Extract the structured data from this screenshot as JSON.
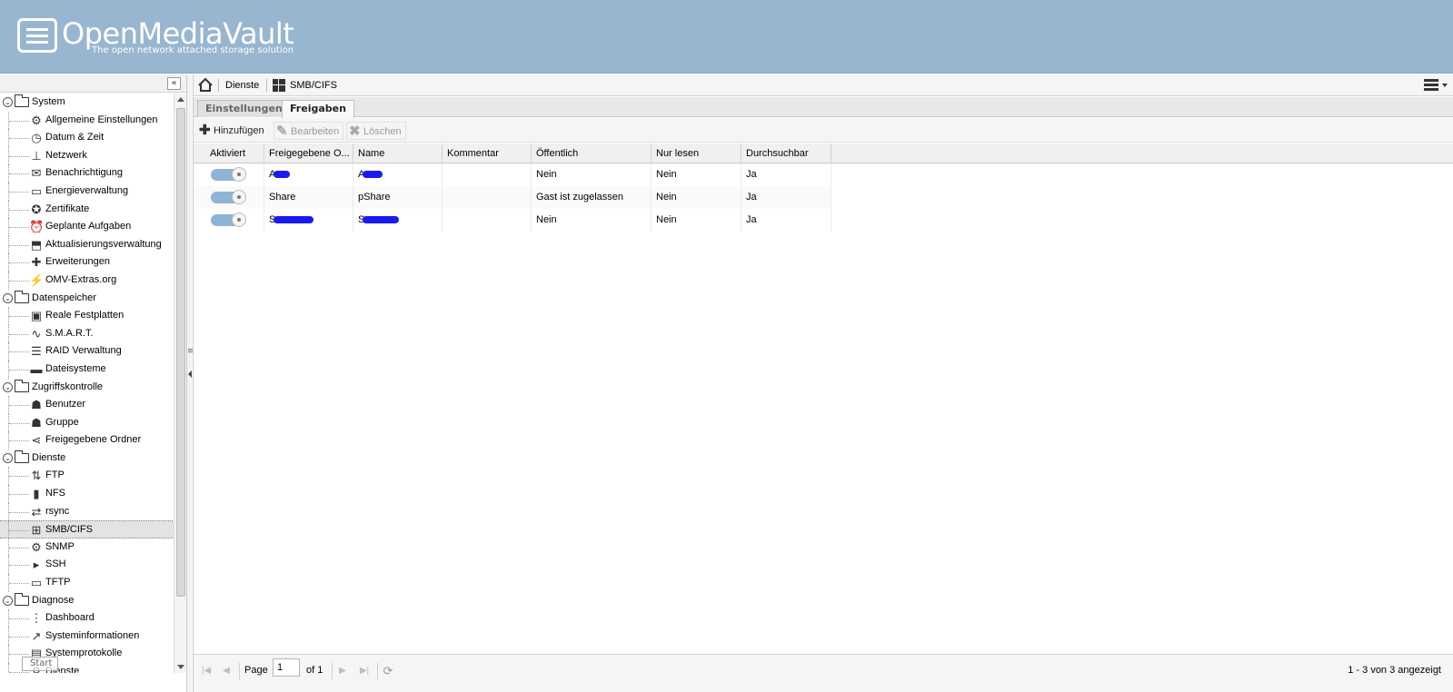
{
  "app": {
    "title": "OpenMediaVault",
    "subtitle": "The open network attached storage solution"
  },
  "sidebar": {
    "collapse_label": "«",
    "groups": [
      {
        "label": "System",
        "items": [
          {
            "label": "Allgemeine Einstellungen",
            "icon": "gear-icon",
            "glyph": "⚙"
          },
          {
            "label": "Datum & Zeit",
            "icon": "clock-icon",
            "glyph": "◷"
          },
          {
            "label": "Netzwerk",
            "icon": "network-icon",
            "glyph": "⊥"
          },
          {
            "label": "Benachrichtigung",
            "icon": "envelope-icon",
            "glyph": "✉"
          },
          {
            "label": "Energieverwaltung",
            "icon": "battery-icon",
            "glyph": "▭"
          },
          {
            "label": "Zertifikate",
            "icon": "certificate-icon",
            "glyph": "✪"
          },
          {
            "label": "Geplante Aufgaben",
            "icon": "alarm-clock-icon",
            "glyph": "⏰"
          },
          {
            "label": "Aktualisierungsverwaltung",
            "icon": "update-icon",
            "glyph": "⬒"
          },
          {
            "label": "Erweiterungen",
            "icon": "puzzle-icon",
            "glyph": "✚"
          },
          {
            "label": "OMV-Extras.org",
            "icon": "plug-icon",
            "glyph": "⚡"
          }
        ]
      },
      {
        "label": "Datenspeicher",
        "items": [
          {
            "label": "Reale Festplatten",
            "icon": "disk-icon",
            "glyph": "▣"
          },
          {
            "label": "S.M.A.R.T.",
            "icon": "heartbeat-icon",
            "glyph": "∿"
          },
          {
            "label": "RAID Verwaltung",
            "icon": "database-icon",
            "glyph": "☰"
          },
          {
            "label": "Dateisysteme",
            "icon": "folder-icon",
            "glyph": "▬"
          }
        ]
      },
      {
        "label": "Zugriffskontrolle",
        "items": [
          {
            "label": "Benutzer",
            "icon": "user-icon",
            "glyph": "☗"
          },
          {
            "label": "Gruppe",
            "icon": "group-icon",
            "glyph": "☗"
          },
          {
            "label": "Freigegebene Ordner",
            "icon": "share-icon",
            "glyph": "⋖"
          }
        ]
      },
      {
        "label": "Dienste",
        "items": [
          {
            "label": "FTP",
            "icon": "ftp-icon",
            "glyph": "⇅"
          },
          {
            "label": "NFS",
            "icon": "nfs-icon",
            "glyph": "▮"
          },
          {
            "label": "rsync",
            "icon": "rsync-icon",
            "glyph": "⇄"
          },
          {
            "label": "SMB/CIFS",
            "icon": "windows-icon",
            "glyph": "⊞",
            "selected": true
          },
          {
            "label": "SNMP",
            "icon": "snmp-icon",
            "glyph": "⚙"
          },
          {
            "label": "SSH",
            "icon": "terminal-icon",
            "glyph": "▸"
          },
          {
            "label": "TFTP",
            "icon": "monitor-icon",
            "glyph": "▭"
          }
        ]
      },
      {
        "label": "Diagnose",
        "items": [
          {
            "label": "Dashboard",
            "icon": "dashboard-icon",
            "glyph": "⋮"
          },
          {
            "label": "Systeminformationen",
            "icon": "chart-line-icon",
            "glyph": "↗"
          },
          {
            "label": "Systemprotokolle",
            "icon": "log-icon",
            "glyph": "▤"
          },
          {
            "label": "Dienste",
            "icon": "services-icon",
            "glyph": "⚲"
          }
        ]
      }
    ],
    "start_label": "Start"
  },
  "breadcrumb": {
    "items": [
      "Dienste",
      "SMB/CIFS"
    ]
  },
  "tabs": [
    {
      "label": "Einstellungen",
      "active": false
    },
    {
      "label": "Freigaben",
      "active": true
    }
  ],
  "toolbar": {
    "add_label": "Hinzufügen",
    "edit_label": "Bearbeiten",
    "delete_label": "Löschen"
  },
  "grid": {
    "columns": [
      "Aktiviert",
      "Freigegebene O...",
      "Name",
      "Kommentar",
      "Öffentlich",
      "Nur lesen",
      "Durchsuchbar"
    ],
    "rows": [
      {
        "enabled": true,
        "shared_folder": "A",
        "name": "A",
        "comment": "",
        "public": "Nein",
        "readonly": "Nein",
        "browseable": "Ja"
      },
      {
        "enabled": true,
        "shared_folder": "Share",
        "name": "pShare",
        "comment": "",
        "public": "Gast ist zugelassen",
        "readonly": "Nein",
        "browseable": "Ja"
      },
      {
        "enabled": true,
        "shared_folder": "S",
        "name": "S",
        "comment": "",
        "public": "Nein",
        "readonly": "Nein",
        "browseable": "Ja"
      }
    ]
  },
  "pager": {
    "page_label": "Page",
    "page_value": "1",
    "of_label": "of 1",
    "status": "1 - 3 von 3 angezeigt"
  },
  "colors": {
    "header_bg": "#98b6d0",
    "toggle_on": "#8fb3d4",
    "redaction": "#1a1af0"
  }
}
